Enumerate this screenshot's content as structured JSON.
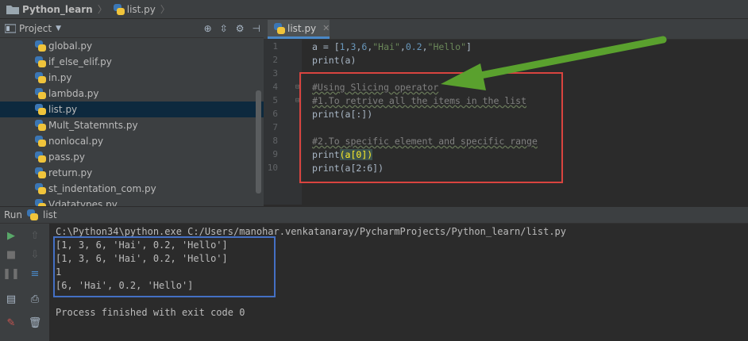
{
  "breadcrumb": {
    "project": "Python_learn",
    "file": "list.py"
  },
  "project_panel": {
    "title": "Project",
    "files": [
      "global.py",
      "if_else_elif.py",
      "in.py",
      "lambda.py",
      "list.py",
      "Mult_Statemnts.py",
      "nonlocal.py",
      "pass.py",
      "return.py",
      "st_indentation_com.py",
      "Vdatatypes.py"
    ],
    "selected": "list.py"
  },
  "editor": {
    "tab_label": "list.py",
    "line_numbers": [
      "1",
      "2",
      "3",
      "4",
      "5",
      "6",
      "7",
      "8",
      "9",
      "10"
    ],
    "lines": {
      "l1_a": "a = [",
      "l1_n1": "1",
      "l1_n2": "3",
      "l1_n3": "6",
      "l1_s1": "\"Hai\"",
      "l1_n4": "0.2",
      "l1_s2": "\"Hello\"",
      "l1_end": "]",
      "l2": "print(a)",
      "l4": "#Using Slicing operator",
      "l5": "#1.To retrive all the items in the list",
      "l6": "print(a[:])",
      "l8": "#2.To specific element and specific range",
      "l9_a": "print",
      "l9_b": "(a[0])",
      "l10": "print(a[2:6])"
    }
  },
  "run": {
    "label": "Run",
    "config": "list",
    "command": "C:\\Python34\\python.exe C:/Users/manohar.venkatanaray/PycharmProjects/Python_learn/list.py",
    "output": [
      "[1, 3, 6, 'Hai', 0.2, 'Hello']",
      "[1, 3, 6, 'Hai', 0.2, 'Hello']",
      "1",
      "[6, 'Hai', 0.2, 'Hello']"
    ],
    "exit_message": "Process finished with exit code 0"
  },
  "colors": {
    "annotation_red": "#d9443f",
    "annotation_blue": "#4470c4",
    "annotation_green": "#5aa12e"
  }
}
